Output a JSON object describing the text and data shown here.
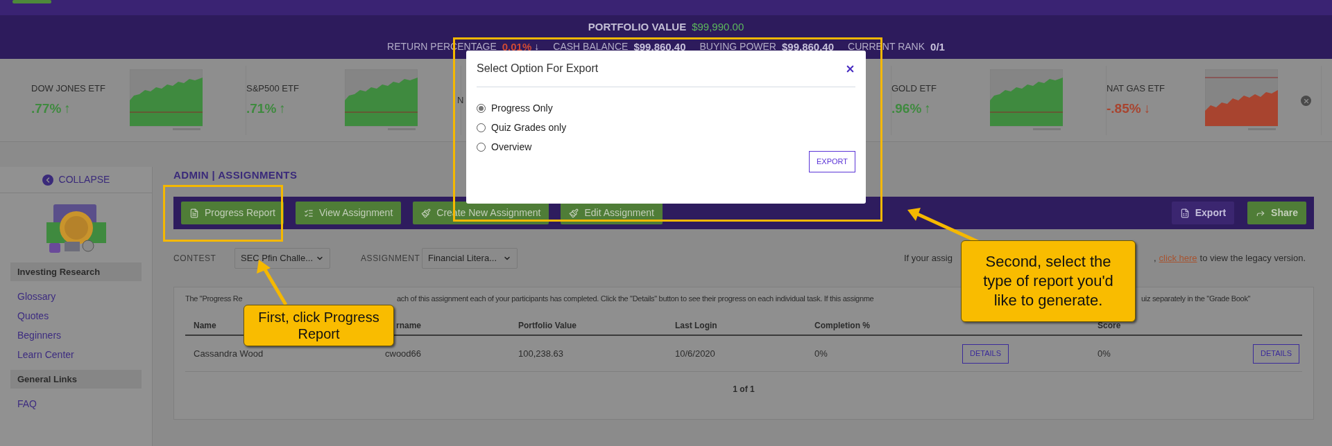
{
  "header": {
    "portfolio_label": "PORTFOLIO VALUE",
    "portfolio_value": "$99,990.00",
    "stats": [
      {
        "label": "RETURN PERCENTAGE",
        "value": "0.01%",
        "arrow": "↓",
        "negative": true
      },
      {
        "label": "CASH BALANCE",
        "value": "$99,860.40",
        "negative": false
      },
      {
        "label": "BUYING POWER",
        "value": "$99,860.40",
        "negative": false
      },
      {
        "label": "CURRENT RANK",
        "value": "0/1",
        "negative": false
      }
    ]
  },
  "tickers": [
    {
      "name": "DOW JONES ETF",
      "change": ".77%",
      "arrow": "↑",
      "color": "#3f8a3f",
      "kind": "full"
    },
    {
      "name": "S&P500 ETF",
      "change": ".71%",
      "arrow": "↑",
      "color": "#3f8a3f",
      "kind": "full"
    },
    {
      "name": "N",
      "kind": "covered"
    },
    {
      "kind": "hidden"
    },
    {
      "name": "GOLD ETF",
      "change": ".96%",
      "arrow": "↑",
      "color": "#3f8a3f",
      "kind": "full"
    },
    {
      "name": "NAT GAS ETF",
      "change": "-.85%",
      "arrow": "↓",
      "color": "#a8442f",
      "kind": "full"
    }
  ],
  "sidebar": {
    "collapse": "COLLAPSE",
    "sections": [
      {
        "title": "Investing Research",
        "links": [
          "Glossary",
          "Quotes",
          "Beginners",
          "Learn Center"
        ]
      },
      {
        "title": "General Links",
        "links": [
          "FAQ"
        ]
      }
    ]
  },
  "page_title": "ADMIN | ASSIGNMENTS",
  "toolbar": {
    "left": [
      {
        "label": "Progress Report"
      },
      {
        "label": "View Assignment"
      },
      {
        "label": "Create New Assignment"
      },
      {
        "label": "Edit Assignment"
      }
    ],
    "right": [
      {
        "label": "Export",
        "kind": "purple"
      },
      {
        "label": "Share",
        "kind": "green"
      }
    ]
  },
  "filters": [
    {
      "label": "CONTEST",
      "value": "SEC Pfin Challe..."
    },
    {
      "label": "ASSIGNMENT",
      "value": "Financial Litera..."
    }
  ],
  "legacy_note": {
    "before": "If your assig",
    "link_prefix": ",",
    "link": "click here",
    "after": "to view the legacy version."
  },
  "description": [
    "The \"Progress Re",
    "ach of this assignment each of your participants has completed. Click the \"Details\" button to see their progress on each individual task. If this assignme",
    "uiz separately in the \"Grade Book\""
  ],
  "table": {
    "columns": [
      "Name",
      "rname",
      "Portfolio Value",
      "Last Login",
      "Completion %",
      "",
      "Score"
    ],
    "rows": [
      {
        "cells": [
          {
            "kind": "text",
            "text": "Cassandra Wood"
          },
          {
            "kind": "text",
            "text": "cwood66"
          },
          {
            "kind": "text",
            "text": "100,238.63"
          },
          {
            "kind": "text",
            "text": "10/6/2020"
          },
          {
            "kind": "text",
            "text": "0%"
          },
          {
            "kind": "button",
            "text": "DETAILS"
          },
          {
            "kind": "text",
            "text": "0%"
          },
          {
            "kind": "button",
            "text": "DETAILS"
          }
        ]
      }
    ],
    "pagination": "1 of 1"
  },
  "modal": {
    "title": "Select Option For Export",
    "options": [
      {
        "label": "Progress Only",
        "selected": true
      },
      {
        "label": "Quiz Grades only",
        "selected": false
      },
      {
        "label": "Overview",
        "selected": false
      }
    ],
    "export_button": "EXPORT"
  },
  "callouts": [
    "First, click Progress Report",
    "Second, select the type of report you'd like to generate."
  ]
}
